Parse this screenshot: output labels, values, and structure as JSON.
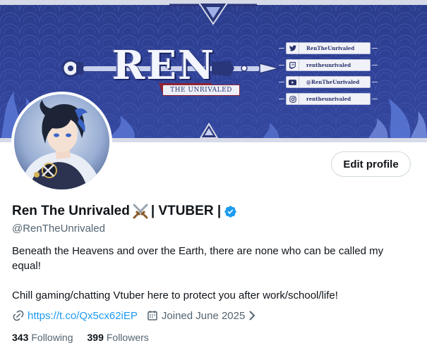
{
  "banner": {
    "logo_title": "REN",
    "logo_subtitle": "THE UNRIVALED",
    "socials": [
      {
        "icon": "twitter-bird-icon",
        "label": "RenTheUnrivaled"
      },
      {
        "icon": "twitch-icon",
        "label": "rentheunrivaled"
      },
      {
        "icon": "youtube-icon",
        "label": "@RenTheUnrivaled"
      },
      {
        "icon": "instagram-icon",
        "label": "rentheunrivaled"
      }
    ],
    "colors": {
      "base": "#2f4196",
      "frame": "#d7dbe8",
      "flame": "#5b78d6",
      "accent": "#8e2434"
    }
  },
  "profile": {
    "name_part1": "Ren The Unrivaled",
    "name_part2": "| VTUBER |",
    "emoji": "crossed-swords-icon",
    "verified": true,
    "handle": "@RenTheUnrivaled",
    "edit_button": "Edit profile",
    "bio": [
      "Beneath the Heavens and over the Earth, there are none who can be called my equal!",
      "Chill gaming/chatting Vtuber here to protect you after work/school/life!"
    ],
    "link": "https://t.co/Qx5cx62iEP",
    "joined": "Joined June 2025",
    "following_count": "343",
    "following_label": "Following",
    "followers_count": "399",
    "followers_label": "Followers"
  },
  "colors": {
    "link": "#1d9bf0",
    "secondary_text": "#536471",
    "verified": "#1d9bf0",
    "text": "#0f1419"
  }
}
